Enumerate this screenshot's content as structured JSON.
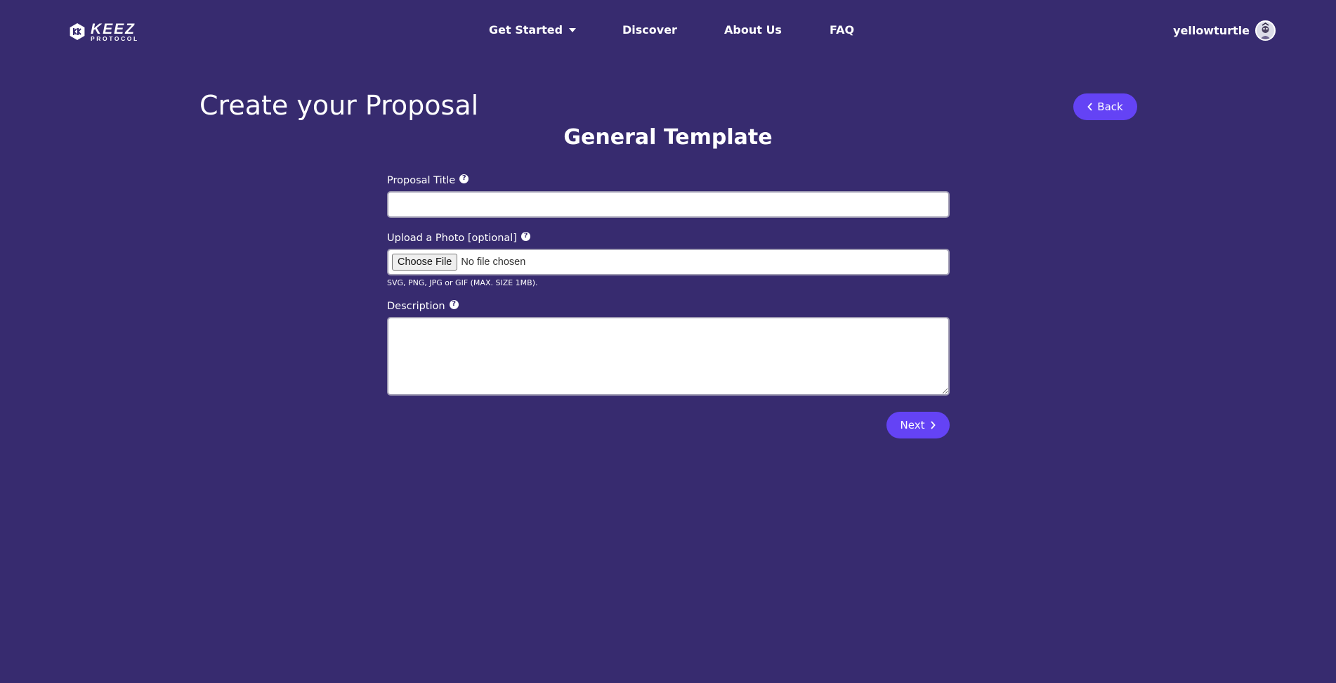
{
  "nav": {
    "logo": {
      "top": "KEEZ",
      "bottom": "PROTOCOL"
    },
    "links": [
      {
        "label": "Get Started",
        "has_dropdown": true
      },
      {
        "label": "Discover"
      },
      {
        "label": "About Us"
      },
      {
        "label": "FAQ"
      }
    ],
    "username": "yellowturtle"
  },
  "page": {
    "title": "Create your Proposal",
    "back_label": "Back",
    "subtitle": "General Template"
  },
  "form": {
    "title_label": "Proposal Title",
    "title_value": "",
    "photo_label": "Upload a Photo [optional]",
    "choose_file_label": "Choose File",
    "file_status": "No file chosen",
    "photo_hint": "SVG, PNG, JPG or GIF (MAX. SIZE 1MB).",
    "description_label": "Description",
    "description_value": "",
    "next_label": "Next"
  },
  "colors": {
    "background": "#372b6f",
    "accent": "#6443f5",
    "text": "#ffffff"
  }
}
